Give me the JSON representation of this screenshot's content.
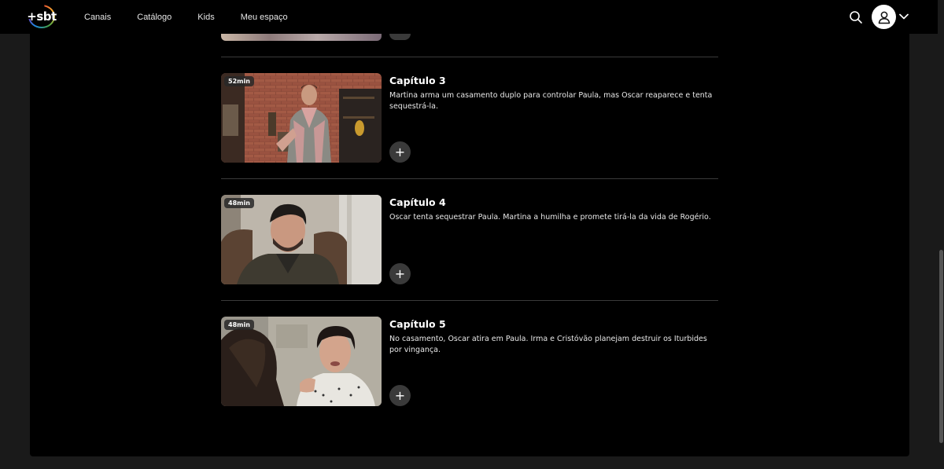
{
  "app": {
    "logo_text": "+sbt"
  },
  "nav": {
    "items": [
      {
        "label": "Canais"
      },
      {
        "label": "Catálogo"
      },
      {
        "label": "Kids"
      },
      {
        "label": "Meu espaço"
      }
    ]
  },
  "header_icons": {
    "search": "search-icon",
    "profile": "user-icon",
    "menu": "chevron-down-icon"
  },
  "episodes": [
    {
      "title": "Capítulo 3",
      "duration": "52min",
      "description": "Martina arma um casamento duplo para controlar Paula, mas Oscar reaparece e tenta sequestrá-la.",
      "add_label": "+"
    },
    {
      "title": "Capítulo 4",
      "duration": "48min",
      "description": "Oscar tenta sequestrar Paula. Martina a humilha e promete tirá-la da vida de Rogério.",
      "add_label": "+"
    },
    {
      "title": "Capítulo 5",
      "duration": "48min",
      "description": "No casamento, Oscar atira em Paula. Irma e Cristóvão planejam destruir os Iturbides por vingança.",
      "add_label": "+"
    }
  ],
  "colors": {
    "background": "#000000",
    "page": "#1a1a1a",
    "divider": "#3a3a3a",
    "button": "#3a3a3a"
  }
}
